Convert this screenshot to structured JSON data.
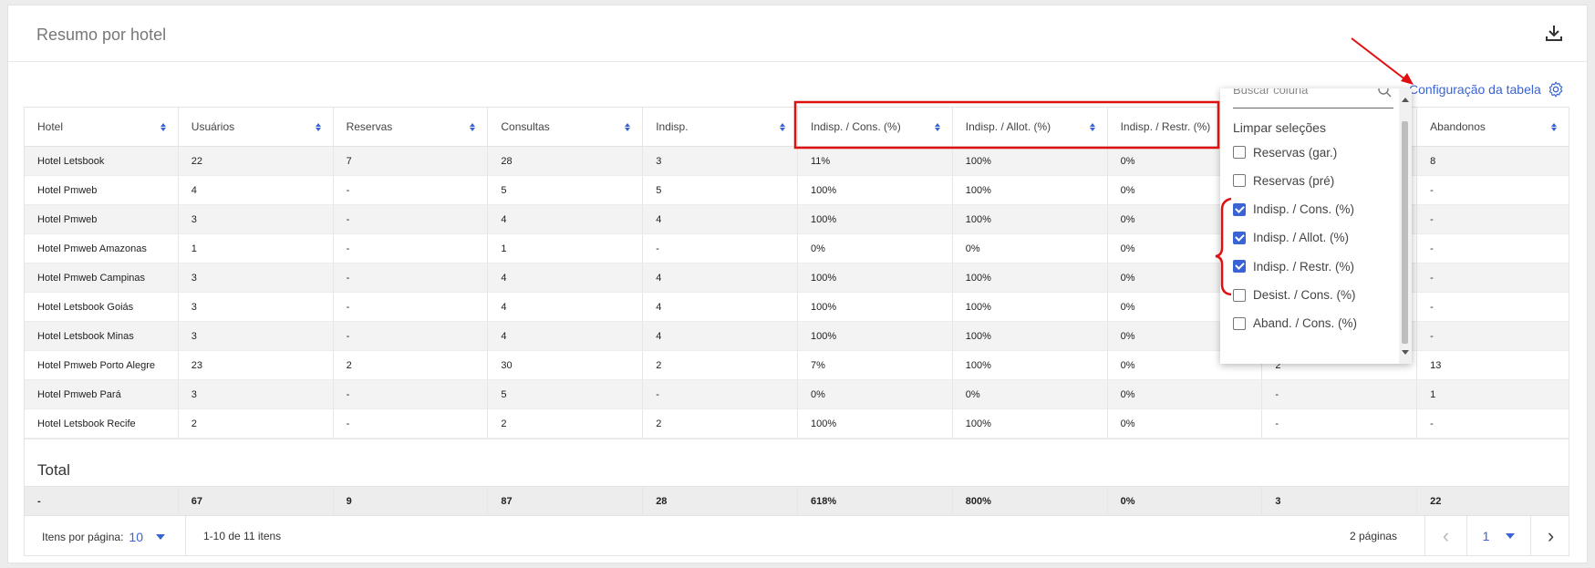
{
  "card": {
    "title": "Resumo por hotel",
    "download_icon": "download-icon"
  },
  "config_link": {
    "label": "Configuração da tabela",
    "icon": "gear-icon"
  },
  "table": {
    "columns": [
      "Hotel",
      "Usuários",
      "Reservas",
      "Consultas",
      "Indisp.",
      "Indisp. / Cons. (%)",
      "Indisp. / Allot. (%)",
      "Indisp. / Restr. (%)",
      "",
      "Abandonos"
    ],
    "rows": [
      [
        "Hotel Letsbook",
        "22",
        "7",
        "28",
        "3",
        "11%",
        "100%",
        "0%",
        "",
        "8"
      ],
      [
        "Hotel Pmweb",
        "4",
        "-",
        "5",
        "5",
        "100%",
        "100%",
        "0%",
        "",
        "-"
      ],
      [
        "Hotel Pmweb",
        "3",
        "-",
        "4",
        "4",
        "100%",
        "100%",
        "0%",
        "",
        "-"
      ],
      [
        "Hotel Pmweb Amazonas",
        "1",
        "-",
        "1",
        "-",
        "0%",
        "0%",
        "0%",
        "",
        "-"
      ],
      [
        "Hotel Pmweb Campinas",
        "3",
        "-",
        "4",
        "4",
        "100%",
        "100%",
        "0%",
        "",
        "-"
      ],
      [
        "Hotel Letsbook Goiás",
        "3",
        "-",
        "4",
        "4",
        "100%",
        "100%",
        "0%",
        "",
        "-"
      ],
      [
        "Hotel Letsbook Minas",
        "3",
        "-",
        "4",
        "4",
        "100%",
        "100%",
        "0%",
        "",
        "-"
      ],
      [
        "Hotel Pmweb Porto Alegre",
        "23",
        "2",
        "30",
        "2",
        "7%",
        "100%",
        "0%",
        "2",
        "13"
      ],
      [
        "Hotel Pmweb Pará",
        "3",
        "-",
        "5",
        "-",
        "0%",
        "0%",
        "0%",
        "-",
        "1"
      ],
      [
        "Hotel Letsbook Recife",
        "2",
        "-",
        "2",
        "2",
        "100%",
        "100%",
        "0%",
        "-",
        "-"
      ]
    ],
    "total_title": "Total",
    "total_row": [
      "-",
      "67",
      "9",
      "87",
      "28",
      "618%",
      "800%",
      "0%",
      "3",
      "22"
    ]
  },
  "pager": {
    "items_per_page_label": "Itens por página:",
    "items_per_page_value": "10",
    "range_label": "1-10 de 11 itens",
    "pages_label": "2 páginas",
    "current_page": "1",
    "prev_icon": "chevron-left-icon",
    "next_icon": "chevron-right-icon"
  },
  "dropdown": {
    "search_placeholder": "Buscar coluna",
    "clear_label": "Limpar seleções",
    "items": [
      {
        "label": "Reservas (gar.)",
        "checked": false
      },
      {
        "label": "Reservas (pré)",
        "checked": false
      },
      {
        "label": "Indisp. / Cons. (%)",
        "checked": true
      },
      {
        "label": "Indisp. / Allot. (%)",
        "checked": true
      },
      {
        "label": "Indisp. / Restr. (%)",
        "checked": true
      },
      {
        "label": "Desist. / Cons. (%)",
        "checked": false
      },
      {
        "label": "Aband. / Cons. (%)",
        "checked": false
      }
    ]
  },
  "colors": {
    "accent": "#3a63d4",
    "annotation": "#e01010"
  }
}
